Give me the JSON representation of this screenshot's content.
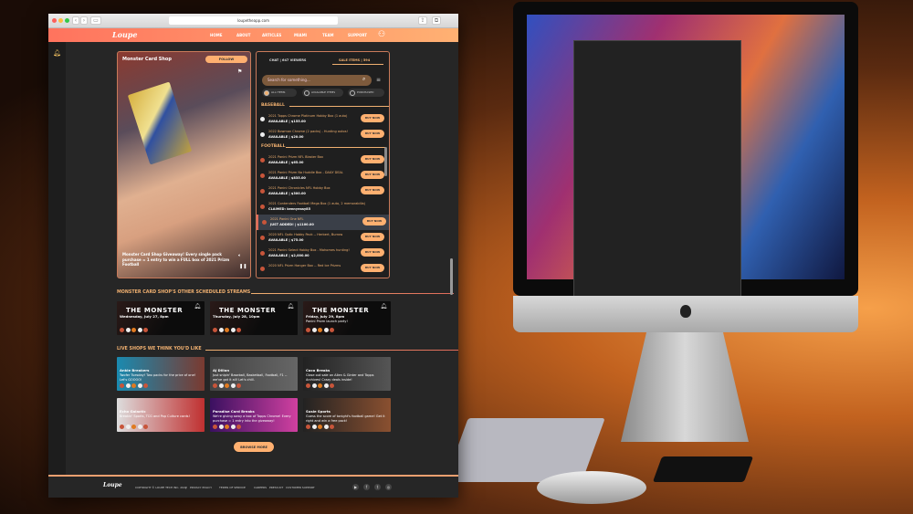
{
  "browser": {
    "url": "loupetheapp.com"
  },
  "nav": {
    "logo": "Loupe",
    "items": [
      "HOME",
      "ABOUT",
      "ARTICLES",
      "MIAMI",
      "TEAM",
      "SUPPORT"
    ]
  },
  "stream": {
    "shop_name": "Monster Card Shop",
    "follow": "FOLLOW",
    "caption": "Monster Card Shop Giveaway! Every single pack purchase = 1 entry to win a FULL box of 2021 Prizm Football"
  },
  "chat": {
    "chat_tab": "CHAT",
    "viewers": "647 VIEWERS",
    "sale_tab": "SALE ITEMS",
    "sale_count": "594",
    "search_placeholder": "Search for something...",
    "filters": [
      "ALL ITEMS",
      "AVAILABLE ITEMS",
      "PURCHASED"
    ],
    "categories": [
      {
        "name": "BASEBALL",
        "items": [
          {
            "name": "2021 Topps Chrome Platinum Hobby Box (1 auto)",
            "status": "AVAILABLE  |  $155.00",
            "button": "BUY NOW"
          },
          {
            "name": "2022 Bowman Chrome (2 packs) - Hunting autos!",
            "status": "AVAILABLE  |  $20.00",
            "button": "BUY NOW"
          }
        ]
      },
      {
        "name": "FOOTBALL",
        "items": [
          {
            "name": "2021 Panini Prizm NFL Blaster Box",
            "status": "AVAILABLE  |  $65.00",
            "button": "BUY NOW"
          },
          {
            "name": "2021 Panini Prizm No Huddle Box - DAILY DEAL",
            "status": "AVAILABLE  |  $835.00",
            "button": "BUY NOW"
          },
          {
            "name": "2021 Panini Chronicles NFL Hobby Box",
            "status": "AVAILABLE  |  $300.00",
            "button": "BUY NOW"
          },
          {
            "name": "2021 Contenders Football Mega Box (1 auto, 2 memorabilia)",
            "status": "CLAIMED: kennyeasy85",
            "button": ""
          },
          {
            "name": "2021 Panini One NFL",
            "status": "JUST ADDED!  |  $1100.00",
            "button": "BUY NOW"
          },
          {
            "name": "2020 NFL Optic Hobby Pack -- Herbert, Burrow",
            "status": "AVAILABLE  |  $75.00",
            "button": "BUY NOW"
          },
          {
            "name": "2021 Panini Select Hobby Box - Mahomes hunting!",
            "status": "AVAILABLE  |  $2,000.00",
            "button": "BUY NOW"
          },
          {
            "name": "2020 NFL Prizm Hanger Box -- Red Ice Prizms",
            "status": "",
            "button": "BUY NOW"
          }
        ]
      }
    ]
  },
  "scheduled": {
    "title": "MONSTER CARD SHOP'S OTHER SCHEDULED STREAMS",
    "cards": [
      {
        "logo": "THE MONSTER",
        "when": "Wednesday, July 27, 8pm",
        "desc": ""
      },
      {
        "logo": "THE MONSTER",
        "when": "Thursday, July 28, 10pm",
        "desc": ""
      },
      {
        "logo": "THE MONSTER",
        "when": "Friday, July 29, 8pm",
        "desc": "Panini Prizm launch party!"
      }
    ]
  },
  "live": {
    "title": "LIVE SHOPS WE THINK YOU'D LIKE",
    "cards": [
      {
        "name": "Ankle Breakers",
        "desc": "Twofer Tuesday! Two packs for the price of one! Let's GOOOO!"
      },
      {
        "name": "AJ Dillon",
        "desc": "Just snipin' Baseball, Basketball, Football, F1 -- we've got it all! Let's chill."
      },
      {
        "name": "Coco Breaks",
        "desc": "Close out sale on Allen & Ginter and Topps Archives! Crazy deals inside!"
      },
      {
        "name": "Echo Galactic",
        "desc": "Breakin' Sports, TCG and Pop Culture cards!"
      },
      {
        "name": "Paradise Card Breaks",
        "desc": "We're giving away a box of Topps Chrome! Every purchase = 1 entry into the giveaway!"
      },
      {
        "name": "Susie Sports",
        "desc": "Guess the score of tonight's football game! Get it right and win a free pack!"
      }
    ]
  },
  "browse_more": "BROWSE MORE",
  "footer": {
    "logo": "Loupe",
    "links": [
      "COPYRIGHT © LOUPE TECH INC. 2022",
      "|",
      "PRIVACY POLICY",
      "TERMS OF SERVICE",
      "CAREERS",
      "PRESS KIT",
      "CUSTOMER SUPPORT"
    ],
    "social": [
      "youtube",
      "facebook",
      "twitter",
      "instagram"
    ]
  }
}
